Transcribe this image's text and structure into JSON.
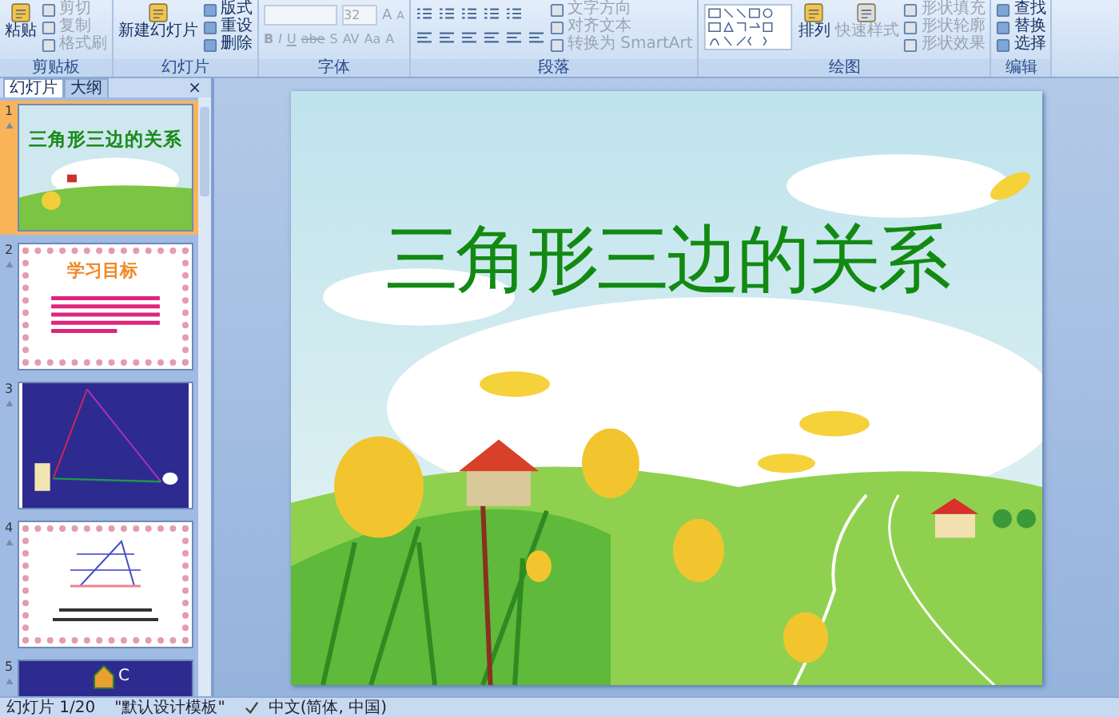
{
  "ribbon": {
    "groups": [
      {
        "label": "剪贴板",
        "kind": "commands",
        "buttons": [
          {
            "label": "粘贴",
            "kind": "large",
            "disabled": false
          },
          {
            "label": "剪切",
            "kind": "small",
            "disabled": true
          },
          {
            "label": "复制",
            "kind": "small",
            "disabled": true
          },
          {
            "label": "格式刷",
            "kind": "small",
            "disabled": true
          }
        ]
      },
      {
        "label": "幻灯片",
        "kind": "commands",
        "buttons": [
          {
            "label": "新建幻灯片",
            "kind": "large",
            "disabled": false
          },
          {
            "label": "版式",
            "kind": "small",
            "disabled": false
          },
          {
            "label": "重设",
            "kind": "small",
            "disabled": false
          },
          {
            "label": "删除",
            "kind": "small",
            "disabled": false
          }
        ]
      },
      {
        "label": "字体",
        "kind": "font",
        "disabled": true,
        "size": "32",
        "grow": "A",
        "shrink": "A",
        "formats": [
          "B",
          "I",
          "U",
          "abe",
          "S",
          "AV",
          "Aa",
          "A"
        ]
      },
      {
        "label": "段落",
        "kind": "paragraph",
        "buttons": [
          {
            "label": "文字方向",
            "kind": "small",
            "disabled": true
          },
          {
            "label": "对齐文本",
            "kind": "small",
            "disabled": true
          },
          {
            "label": "转换为 SmartArt",
            "kind": "small",
            "disabled": true
          }
        ]
      },
      {
        "label": "绘图",
        "kind": "drawing",
        "buttons": [
          {
            "label": "排列",
            "kind": "large",
            "disabled": false
          },
          {
            "label": "快速样式",
            "kind": "large",
            "disabled": true
          },
          {
            "label": "形状填充",
            "kind": "small",
            "disabled": true
          },
          {
            "label": "形状轮廓",
            "kind": "small",
            "disabled": true
          },
          {
            "label": "形状效果",
            "kind": "small",
            "disabled": true
          }
        ]
      },
      {
        "label": "编辑",
        "kind": "commands",
        "buttons": [
          {
            "label": "查找",
            "kind": "small",
            "disabled": false
          },
          {
            "label": "替换",
            "kind": "small",
            "disabled": false
          },
          {
            "label": "选择",
            "kind": "small",
            "disabled": false
          }
        ]
      }
    ]
  },
  "slides_pane": {
    "tabs": [
      {
        "label": "幻灯片",
        "selected": true
      },
      {
        "label": "大纲",
        "selected": false
      }
    ],
    "close": "×",
    "slides": [
      {
        "number": "1",
        "kind": "title",
        "selected": true,
        "title": "三角形三边的关系"
      },
      {
        "number": "2",
        "kind": "goals",
        "selected": false,
        "title": "学习目标"
      },
      {
        "number": "3",
        "kind": "triangle",
        "selected": false
      },
      {
        "number": "4",
        "kind": "definition",
        "selected": false
      },
      {
        "number": "5",
        "kind": "partial",
        "selected": false,
        "label": "C"
      }
    ]
  },
  "slide": {
    "title": "三角形三边的关系"
  },
  "status_bar": {
    "slide": "幻灯片 1/20",
    "theme": "\"默认设计模板\"",
    "language": "中文(简体, 中国)"
  }
}
